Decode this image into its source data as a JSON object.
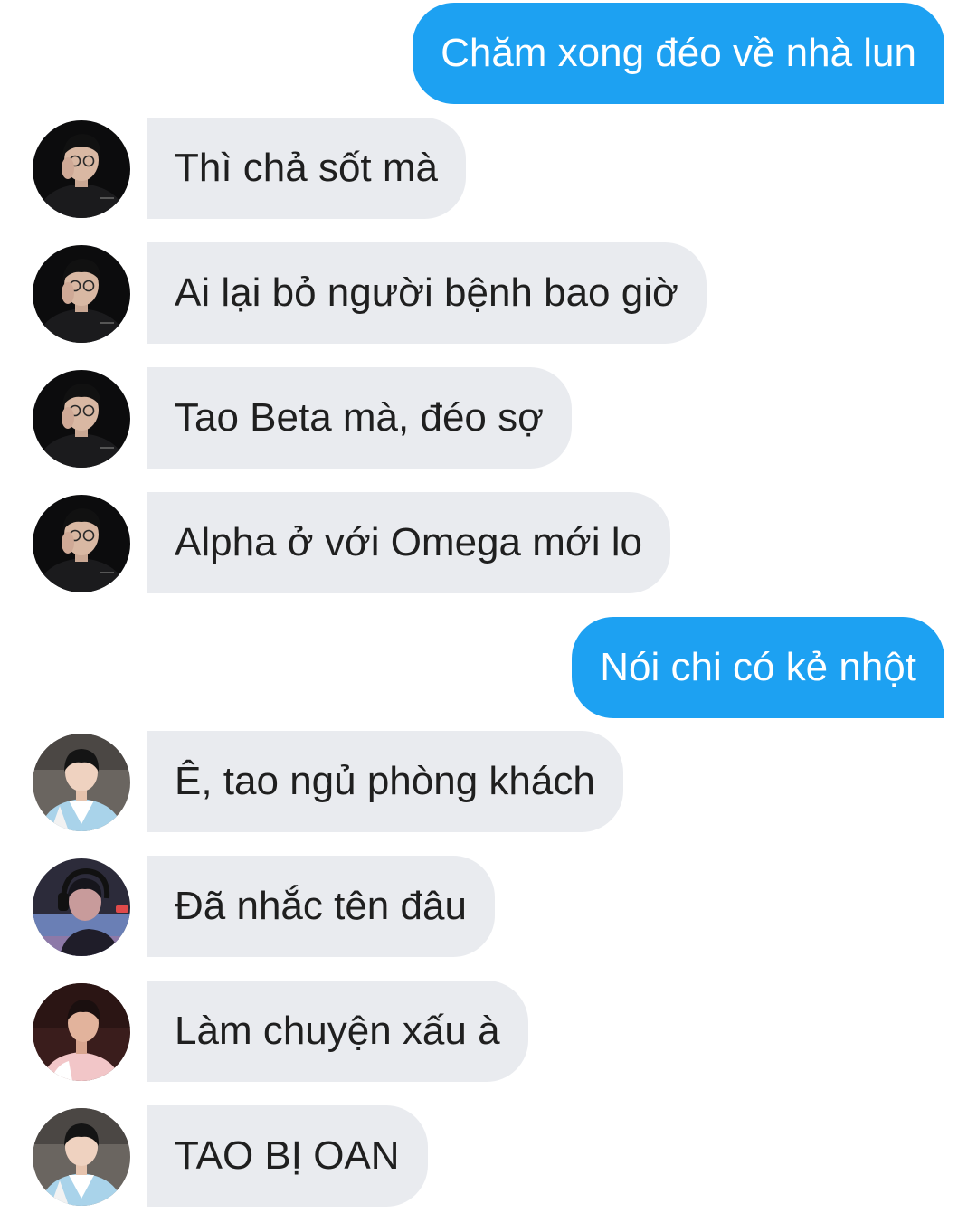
{
  "conversation": {
    "messages": [
      {
        "direction": "out",
        "avatar": null,
        "text": "Chăm xong đéo về nhà lun"
      },
      {
        "direction": "in",
        "avatar": "avatar-dark-glasses-icon",
        "text": "Thì chả sốt mà"
      },
      {
        "direction": "in",
        "avatar": "avatar-dark-glasses-icon",
        "text": "Ai lại bỏ người bệnh bao giờ"
      },
      {
        "direction": "in",
        "avatar": "avatar-dark-glasses-icon",
        "text": "Tao Beta mà, đéo sợ"
      },
      {
        "direction": "in",
        "avatar": "avatar-dark-glasses-icon",
        "text": "Alpha ở với Omega mới lo"
      },
      {
        "direction": "out",
        "avatar": null,
        "text": "Nói chi có kẻ nhột"
      },
      {
        "direction": "in",
        "avatar": "avatar-hanbok-icon",
        "text": "Ê, tao ngủ phòng khách"
      },
      {
        "direction": "in",
        "avatar": "avatar-headset-icon",
        "text": "Đã nhắc tên đâu"
      },
      {
        "direction": "in",
        "avatar": "avatar-pink-jacket-icon",
        "text": "Làm chuyện xấu à"
      },
      {
        "direction": "in",
        "avatar": "avatar-hanbok-icon",
        "text": "TAO BỊ OAN"
      }
    ]
  },
  "colors": {
    "outgoing_bubble": "#1da1f2",
    "outgoing_text": "#ffffff",
    "incoming_bubble": "#e9ebef",
    "incoming_text": "#1f1f1f",
    "background": "#ffffff"
  }
}
